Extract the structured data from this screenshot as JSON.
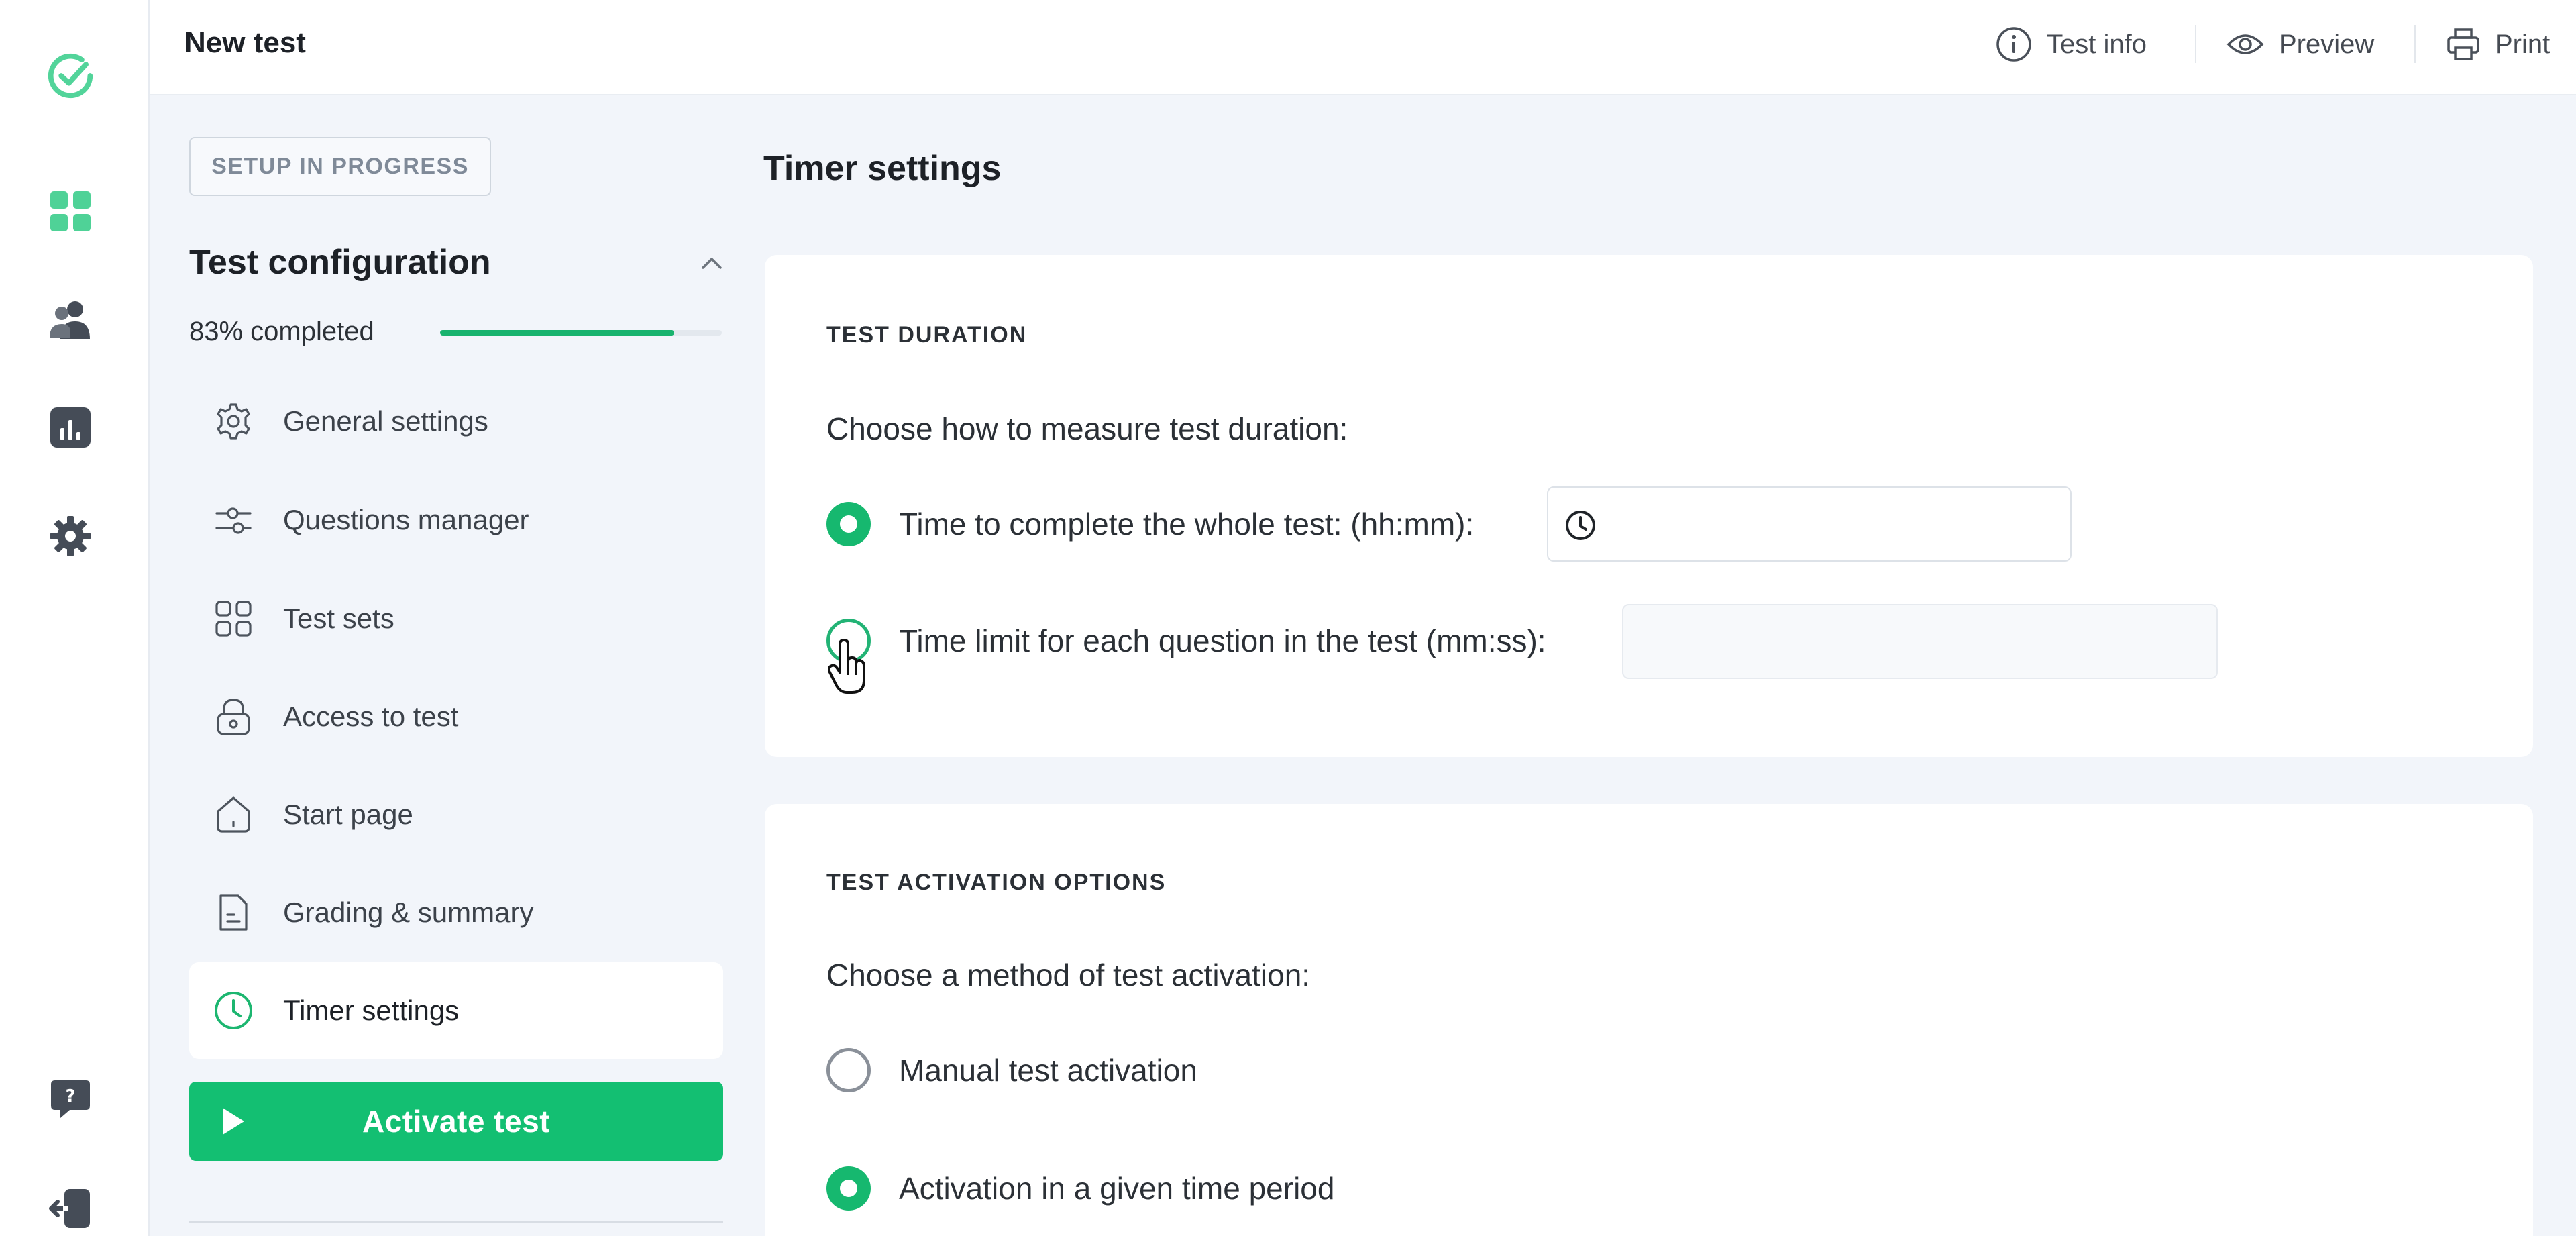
{
  "header": {
    "title": "New test",
    "actions": [
      {
        "label": "Test info",
        "icon": "info-icon"
      },
      {
        "label": "Preview",
        "icon": "eye-icon"
      },
      {
        "label": "Print",
        "icon": "printer-icon"
      }
    ]
  },
  "rail": {
    "logo_icon": "check-circle-logo",
    "items": [
      {
        "icon": "dashboard-grid-icon"
      },
      {
        "icon": "users-icon"
      },
      {
        "icon": "chart-icon"
      },
      {
        "icon": "gear-icon"
      }
    ],
    "bottom_items": [
      {
        "icon": "help-chat-icon"
      },
      {
        "icon": "logout-icon"
      }
    ]
  },
  "sidebar": {
    "status": "SETUP IN PROGRESS",
    "config_title": "Test configuration",
    "progress_text": "83% completed",
    "progress_value": 0.83,
    "items": [
      {
        "label": "General settings",
        "icon": "gear-outline-icon"
      },
      {
        "label": "Questions manager",
        "icon": "sliders-icon"
      },
      {
        "label": "Test sets",
        "icon": "grid-squares-icon"
      },
      {
        "label": "Access to test",
        "icon": "lock-icon"
      },
      {
        "label": "Start page",
        "icon": "home-icon"
      },
      {
        "label": "Grading & summary",
        "icon": "document-icon"
      },
      {
        "label": "Timer settings",
        "icon": "clock-icon",
        "active": true
      }
    ],
    "activate_label": "Activate test"
  },
  "main": {
    "section_title": "Timer settings",
    "duration_card": {
      "heading": "TEST DURATION",
      "prompt": "Choose how to measure test duration:",
      "options": [
        {
          "label": "Time to complete the whole test: (hh:mm):",
          "checked": true,
          "input_value": ""
        },
        {
          "label": "Time limit for each question in the test (mm:ss):",
          "checked": false,
          "input_value": ""
        }
      ]
    },
    "activation_card": {
      "heading": "TEST ACTIVATION OPTIONS",
      "prompt": "Choose a method of test activation:",
      "options": [
        {
          "label": "Manual test activation",
          "checked": false
        },
        {
          "label": "Activation in a given time period",
          "checked": true
        }
      ]
    }
  },
  "colors": {
    "accent": "#13bf72",
    "page_bg": "#f2f5fa",
    "card_bg": "#ffffff",
    "rail_icon": "#3f4651"
  }
}
